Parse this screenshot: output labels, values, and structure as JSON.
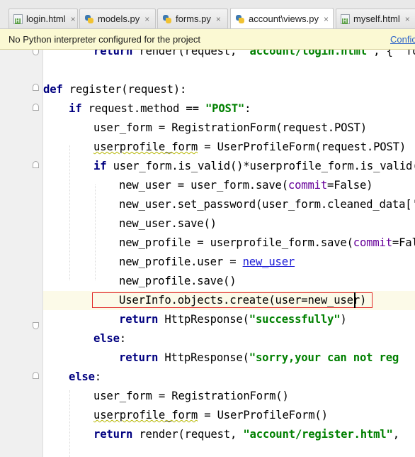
{
  "tabs": [
    {
      "label": "login.html",
      "icon": "html-file-icon",
      "active": false
    },
    {
      "label": "models.py",
      "icon": "python-file-icon",
      "active": false
    },
    {
      "label": "forms.py",
      "icon": "python-file-icon",
      "active": false
    },
    {
      "label": "account\\views.py",
      "icon": "python-file-icon",
      "active": true
    },
    {
      "label": "myself.html",
      "icon": "html-file-icon",
      "active": false
    }
  ],
  "tab_close_glyph": "×",
  "notification": {
    "message": "No Python interpreter configured for the project",
    "action": "Confic"
  },
  "code": {
    "line0": {
      "kw": "return",
      "a": " render(request, ",
      "s": "'account/login.html'",
      "b": ", { 'fo"
    },
    "line1": {
      "kw": "def",
      "a": " register(request):"
    },
    "line2": {
      "kw": "if",
      "a": " request.method == ",
      "s": "\"POST\"",
      "b": ":"
    },
    "line3": {
      "a": "user_form = RegistrationForm(request.POST)"
    },
    "line4": {
      "w": "userprofile_form",
      "a": " = UserProfileForm(request.POST)"
    },
    "line5": {
      "kw": "if",
      "a": " user_form.is_valid()*userprofile_form.is_valid()"
    },
    "line6": {
      "a": "new_user = user_form.save(",
      "p": "commit",
      "b": "=False)"
    },
    "line7": {
      "a": "new_user.set_password(user_form.cleaned_data['p"
    },
    "line8": {
      "a": "new_user.save()"
    },
    "line9": {
      "a": "new_profile = userprofile_form.save(",
      "p": "commit",
      "b": "=False"
    },
    "line10": {
      "a": "new_profile.user = ",
      "l": "new_user"
    },
    "line11": {
      "a": "new_profile.save()"
    },
    "line12": {
      "a": "UserInfo.objects.create(user=new_user)"
    },
    "line13": {
      "kw": "return",
      "a": " HttpResponse(",
      "s": "\"successfully\"",
      "b": ")"
    },
    "line14": {
      "kw": "else",
      "a": ":"
    },
    "line15": {
      "kw": "return",
      "a": " HttpResponse(",
      "s": "\"sorry,your can not reg"
    },
    "line16": {
      "kw": "else",
      "a": ":"
    },
    "line17": {
      "a": "user_form = RegistrationForm()"
    },
    "line18": {
      "w": "userprofile_form",
      "a": " = UserProfileForm()"
    },
    "line19": {
      "kw": "return",
      "a": " render(request, ",
      "s": "\"account/register.html\"",
      "b": ","
    }
  }
}
